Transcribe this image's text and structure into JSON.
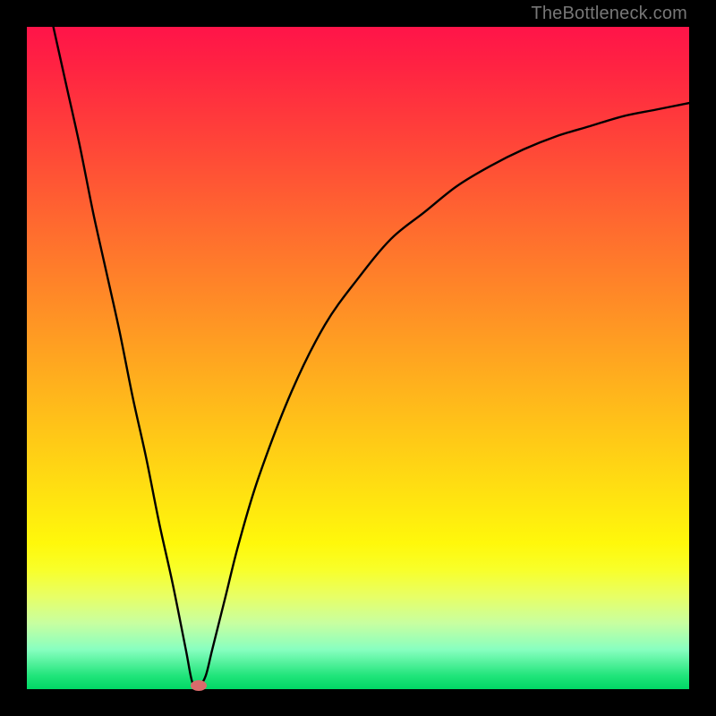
{
  "watermark": "TheBottleneck.com",
  "chart_data": {
    "type": "line",
    "title": "",
    "xlabel": "",
    "ylabel": "",
    "xlim": [
      0,
      100
    ],
    "ylim": [
      0,
      100
    ],
    "grid": false,
    "legend": false,
    "series": [
      {
        "name": "curve",
        "x": [
          4,
          6,
          8,
          10,
          12,
          14,
          16,
          18,
          20,
          22,
          24,
          25,
          26,
          27,
          28,
          30,
          32,
          35,
          40,
          45,
          50,
          55,
          60,
          65,
          70,
          75,
          80,
          85,
          90,
          95,
          100
        ],
        "y": [
          100,
          91,
          82,
          72,
          63,
          54,
          44,
          35,
          25,
          16,
          6,
          1,
          0.5,
          2,
          6,
          14,
          22,
          32,
          45,
          55,
          62,
          68,
          72,
          76,
          79,
          81.5,
          83.5,
          85,
          86.5,
          87.5,
          88.5
        ]
      }
    ],
    "annotations": [
      {
        "name": "minimum-marker",
        "x": 26,
        "y": 0.5
      }
    ]
  },
  "gradient_colors": {
    "top": "#ff1449",
    "mid_orange": "#ff8d26",
    "mid_yellow": "#fff80b",
    "bottom": "#00d865"
  }
}
